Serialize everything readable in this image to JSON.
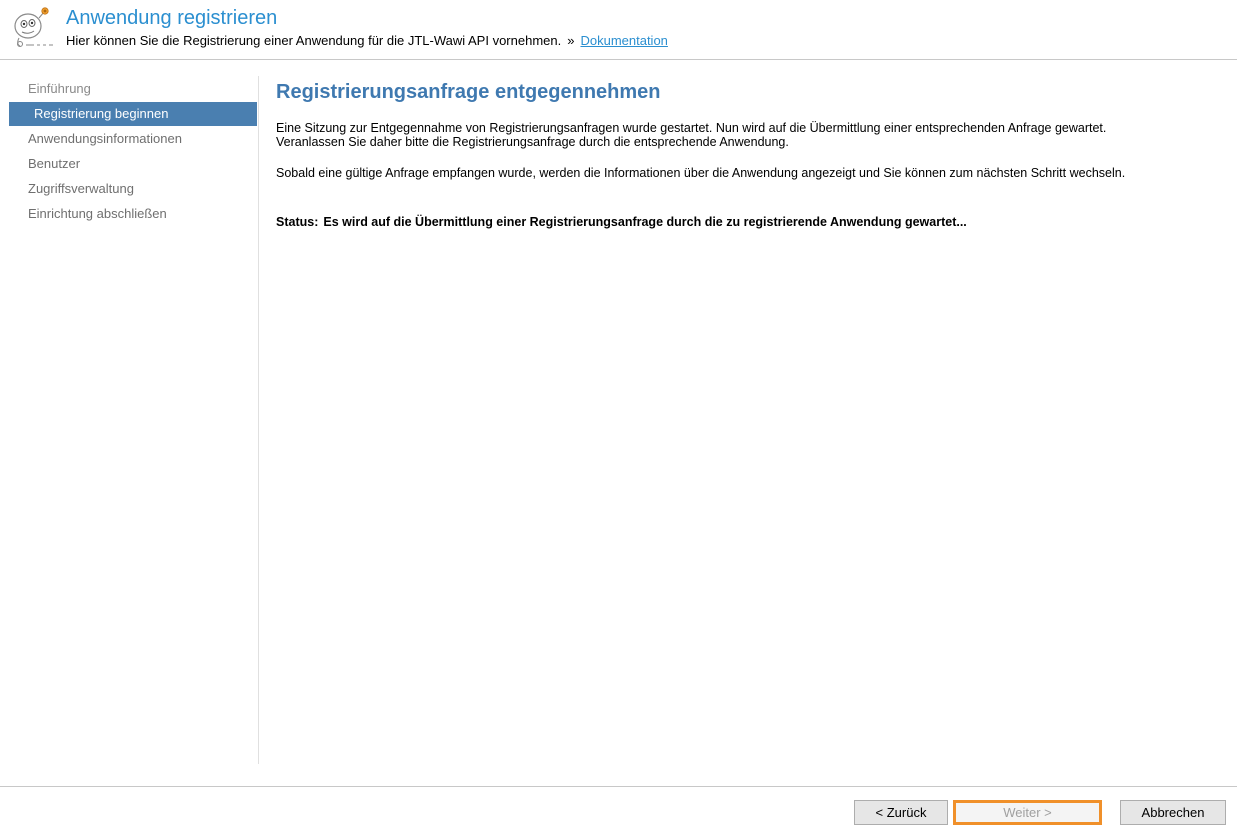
{
  "header": {
    "title": "Anwendung registrieren",
    "subtitle": "Hier können Sie die Registrierung einer Anwendung für die JTL-Wawi API vornehmen.",
    "separator": "»",
    "doc_link": "Dokumentation",
    "icon": "robot-mascot-icon"
  },
  "sidebar": {
    "items": [
      {
        "label": "Einführung",
        "state": "done"
      },
      {
        "label": "Registrierung beginnen",
        "state": "active"
      },
      {
        "label": "Anwendungsinformationen",
        "state": "pending"
      },
      {
        "label": "Benutzer",
        "state": "pending"
      },
      {
        "label": "Zugriffsverwaltung",
        "state": "pending"
      },
      {
        "label": "Einrichtung abschließen",
        "state": "pending"
      }
    ]
  },
  "main": {
    "title": "Registrierungsanfrage entgegennehmen",
    "paragraph1_line1": "Eine Sitzung zur Entgegennahme von Registrierungsanfragen wurde gestartet. Nun wird auf die Übermittlung einer entsprechenden Anfrage gewartet.",
    "paragraph1_line2": "Veranlassen Sie daher bitte die Registrierungsanfrage durch die entsprechende Anwendung.",
    "paragraph2": "Sobald eine gültige Anfrage empfangen wurde, werden die Informationen über die Anwendung angezeigt und Sie können zum nächsten Schritt wechseln.",
    "status_label": "Status:",
    "status_text": "Es wird auf die Übermittlung einer Registrierungsanfrage durch die zu registrierende Anwendung gewartet..."
  },
  "footer": {
    "back_label": "< Zurück",
    "next_label": "Weiter >",
    "cancel_label": "Abbrechen"
  },
  "colors": {
    "accent": "#2b8fd0",
    "active_nav": "#4a7fb0",
    "focus_border": "#f0902a"
  }
}
